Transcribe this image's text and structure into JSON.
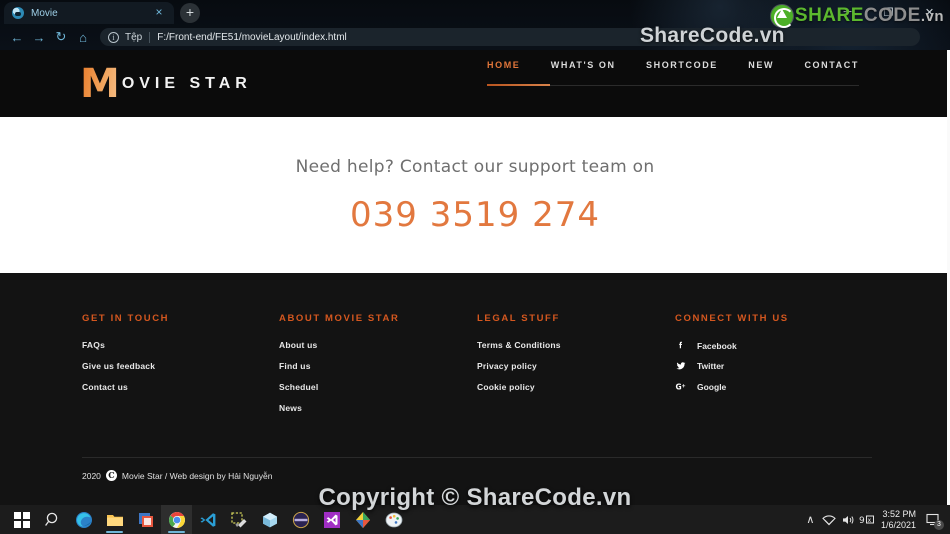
{
  "browser": {
    "tab": {
      "title": "Movie",
      "favicon_name": "globe-icon",
      "close_label": "×"
    },
    "new_tab_label": "+",
    "nav": {
      "back": "←",
      "forward": "→",
      "reload": "↻",
      "home": "⌂"
    },
    "address": {
      "info_label": "i",
      "scheme_label": "Tệp",
      "url": "F:/Front-end/FE51/movieLayout/index.html"
    },
    "window_controls": {
      "minimize": "─",
      "maximize": "❐",
      "close": "✕"
    }
  },
  "watermark": {
    "logo_share": "SHARE",
    "logo_code": "CODE",
    "logo_tld": ".vn",
    "header_text": "ShareCode.vn",
    "bottom_text": "Copyright © ShareCode.vn"
  },
  "site": {
    "logo": {
      "initial": "M",
      "rest": "OVIE STAR"
    },
    "nav_items": [
      {
        "label": "HOME",
        "active": true
      },
      {
        "label": "WHAT'S ON",
        "active": false
      },
      {
        "label": "SHORTCODE",
        "active": false
      },
      {
        "label": "NEW",
        "active": false
      },
      {
        "label": "CONTACT",
        "active": false
      }
    ]
  },
  "support": {
    "headline": "Need help? Contact our support team on",
    "phone": "039 3519 274",
    "phone_color": "#e2783f"
  },
  "footer": {
    "columns": [
      {
        "title": "GET IN TOUCH",
        "links": [
          "FAQs",
          "Give us feedback",
          "Contact us"
        ]
      },
      {
        "title": "ABOUT MOVIE STAR",
        "links": [
          "About us",
          "Find us",
          "Scheduel",
          "News"
        ]
      },
      {
        "title": "LEGAL STUFF",
        "links": [
          "Terms & Conditions",
          "Privacy policy",
          "Cookie policy"
        ]
      }
    ],
    "social": {
      "title": "CONNECT WITH US",
      "items": [
        {
          "label": "Facebook",
          "icon": "facebook-icon"
        },
        {
          "label": "Twitter",
          "icon": "twitter-icon"
        },
        {
          "label": "Google",
          "icon": "google-plus-icon"
        }
      ]
    },
    "copyright": {
      "year": "2020",
      "symbol": "C",
      "text": "Movie Star / Web design by Hải Nguyễn"
    },
    "accent_color": "#d4571f"
  },
  "taskbar": {
    "apps": [
      {
        "name": "start-button"
      },
      {
        "name": "search-button"
      },
      {
        "name": "edge-icon"
      },
      {
        "name": "file-explorer-icon"
      },
      {
        "name": "office-app-icon"
      },
      {
        "name": "chrome-icon"
      },
      {
        "name": "vscode-icon"
      },
      {
        "name": "tools-icon"
      },
      {
        "name": "3d-viewer-icon"
      },
      {
        "name": "purple-app-icon"
      },
      {
        "name": "visual-studio-icon"
      },
      {
        "name": "colored-app-icon"
      },
      {
        "name": "paint-icon"
      }
    ],
    "tray": {
      "chevron": "∧",
      "network": "network-icon",
      "volume": "volume-icon",
      "input": "input-indicator-icon",
      "time": "3:52 PM",
      "date": "1/6/2021",
      "notification_count": "3"
    }
  }
}
